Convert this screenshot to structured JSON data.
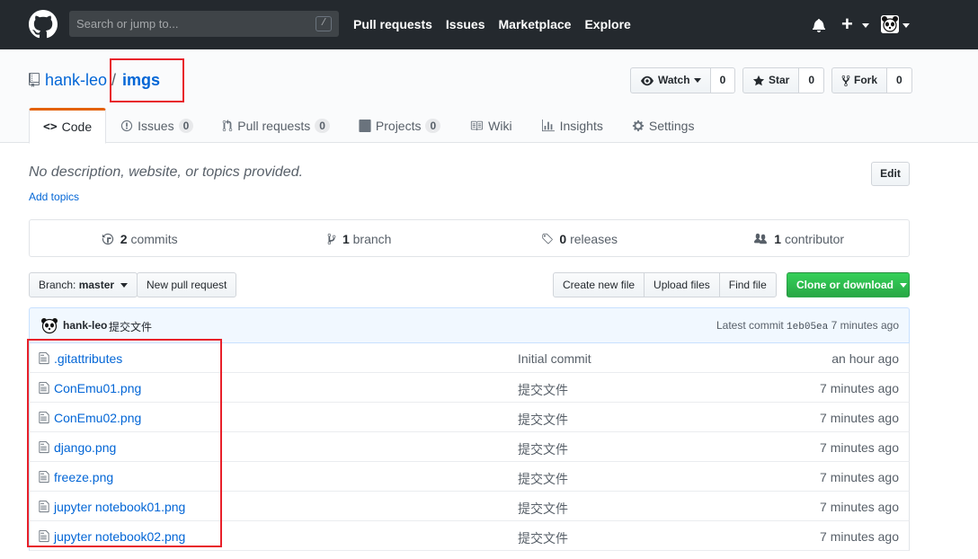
{
  "header": {
    "search_placeholder": "Search or jump to...",
    "search_shortcut": "/",
    "nav": [
      "Pull requests",
      "Issues",
      "Marketplace",
      "Explore"
    ],
    "plus": "+"
  },
  "repo": {
    "owner": "hank-leo",
    "separator": "/",
    "name": "imgs",
    "watch": {
      "label": "Watch",
      "count": "0"
    },
    "star": {
      "label": "Star",
      "count": "0"
    },
    "fork": {
      "label": "Fork",
      "count": "0"
    }
  },
  "tabs": [
    {
      "label": "Code"
    },
    {
      "label": "Issues",
      "count": "0"
    },
    {
      "label": "Pull requests",
      "count": "0"
    },
    {
      "label": "Projects",
      "count": "0"
    },
    {
      "label": "Wiki"
    },
    {
      "label": "Insights"
    },
    {
      "label": "Settings"
    }
  ],
  "description": {
    "text": "No description, website, or topics provided.",
    "add_topics": "Add topics",
    "edit": "Edit"
  },
  "summary": {
    "commits": {
      "count": "2",
      "label": "commits"
    },
    "branches": {
      "count": "1",
      "label": "branch"
    },
    "releases": {
      "count": "0",
      "label": "releases"
    },
    "contributors": {
      "count": "1",
      "label": "contributor"
    }
  },
  "file_nav": {
    "branch_label": "Branch:",
    "branch": "master",
    "new_pr": "New pull request",
    "create_file": "Create new file",
    "upload": "Upload files",
    "find": "Find file",
    "clone": "Clone or download"
  },
  "commit": {
    "author": "hank-leo",
    "message": "提交文件",
    "latest_label": "Latest commit",
    "sha": "1eb05ea",
    "age": "7 minutes ago"
  },
  "files": [
    {
      "name": ".gitattributes",
      "message": "Initial commit",
      "age": "an hour ago"
    },
    {
      "name": "ConEmu01.png",
      "message": "提交文件",
      "age": "7 minutes ago"
    },
    {
      "name": "ConEmu02.png",
      "message": "提交文件",
      "age": "7 minutes ago"
    },
    {
      "name": "django.png",
      "message": "提交文件",
      "age": "7 minutes ago"
    },
    {
      "name": "freeze.png",
      "message": "提交文件",
      "age": "7 minutes ago"
    },
    {
      "name": "jupyter notebook01.png",
      "message": "提交文件",
      "age": "7 minutes ago"
    },
    {
      "name": "jupyter notebook02.png",
      "message": "提交文件",
      "age": "7 minutes ago"
    }
  ],
  "colors": {
    "header_bg": "#24292e",
    "link": "#0366d6",
    "clone_green": "#28a745",
    "highlight_red": "#e8202a",
    "tab_accent": "#e36209"
  }
}
